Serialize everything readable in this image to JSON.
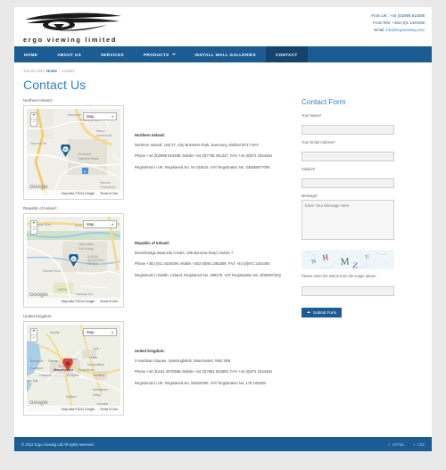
{
  "brand": {
    "logo_text": "ergo viewing limited",
    "logo_icon": "eye-logo-icon"
  },
  "header": {
    "phone_uk_label": "From UK :",
    "phone_uk": "+44 (0)2895 810488",
    "phone_roi_label": "From ROI:",
    "phone_roi": "+353 (0)1 4429199",
    "email_label": "Email:",
    "email": "info@ergoviewing.com"
  },
  "nav": {
    "items": [
      {
        "label": "HOME",
        "active": false,
        "dropdown": false
      },
      {
        "label": "ABOUT US",
        "active": false,
        "dropdown": false
      },
      {
        "label": "SERVICES",
        "active": false,
        "dropdown": false
      },
      {
        "label": "PRODUCTS",
        "active": false,
        "dropdown": true
      },
      {
        "label": "INSTALL WALL GALLERIES",
        "active": false,
        "dropdown": false
      },
      {
        "label": "CONTACT",
        "active": true,
        "dropdown": false
      }
    ]
  },
  "breadcrumb": {
    "prefix": "You are here:",
    "home": "Home",
    "separator": "»",
    "current": "Contact"
  },
  "page_title": "Contact Us",
  "regions": [
    {
      "label": "Northern Ireland:",
      "map": {
        "type_label": "Map",
        "zoom_in": "+",
        "zoom_out": "−",
        "attribution": "Map data ©2014 Google",
        "terms": "Terms of Use",
        "provider": "Google",
        "pin_icon": "map-marker-icon"
      },
      "address": {
        "heading": "Northern Ireland:",
        "line1": "Northern Ireland: Unit 27, City Business Park, Dunmurry, Belfast BT17 9HY",
        "line2": "Phone +44 (0)2895 810488, Mobile +44 (0)7735 461327, FAX +44 (0)871 2344484",
        "line3": "Registered in UK. Registered No. NI 033615. VAT Registration No. GB838677005"
      }
    },
    {
      "label": "Republic of Ireland:",
      "map": {
        "type_label": "Map",
        "zoom_in": "+",
        "zoom_out": "−",
        "attribution": "Map data ©2014 Google",
        "terms": "Terms of Use",
        "provider": "Google",
        "pin_icon": "map-marker-icon"
      },
      "address": {
        "heading": "Republic of Ireland:",
        "line1": "Broombridge Business Centre, 285 Bannow Road, Dublin 7",
        "line2": "Phone +353 (0)1 4429199, Mobile +353 (0)85 1383359, FAX +44 (0)871 2344484",
        "line3": "Registered in Dublin, Ireland. Registered No. 480275. VAT Registration No. IE9849734Q"
      }
    },
    {
      "label": "United Kingdom:",
      "map": {
        "type_label": "Map",
        "zoom_in": "+",
        "zoom_out": "−",
        "attribution": "Map data ©2014 Google",
        "terms": "Terms of Use",
        "provider": "Google",
        "pin_icon": "map-marker-icon"
      },
      "address": {
        "heading": "United Kingdom:",
        "line1": "3 Hardman Square, Spinningfields, Manchester, M63 3EB",
        "line2": "Phone +44 (0)161 4070388, Mobile +44 (0)7961 542650, FAX +44 (0)871 2344484",
        "line3": "Registered in UK. Registered No. NI6020/95. VAT Registration No. 179 106408"
      }
    }
  ],
  "form": {
    "title": "Contact Form",
    "name_label": "Your Name*",
    "name_value": "",
    "email_label": "Your Email Address*",
    "email_value": "",
    "subject_label": "Subject*",
    "subject_value": "",
    "message_label": "Message*",
    "message_placeholder": "Enter Your Message Here",
    "captcha_letters": [
      "N",
      "H",
      "M",
      "Z",
      "U"
    ],
    "captcha_note": "Please enter the letters from the image above:",
    "captcha_value": "",
    "submit_label": "Submit Form"
  },
  "footer": {
    "copyright": "© 2012 Ergo Viewing Ltd All rights reserved.",
    "links": [
      {
        "label": "XHTML",
        "icon": "check-icon"
      },
      {
        "label": "CSS",
        "icon": "check-icon"
      }
    ]
  },
  "colors": {
    "brand_blue": "#1a5c93",
    "accent_blue": "#2f7fc6",
    "nav_active": "#14446d",
    "page_bg": "#e9e9e9"
  }
}
